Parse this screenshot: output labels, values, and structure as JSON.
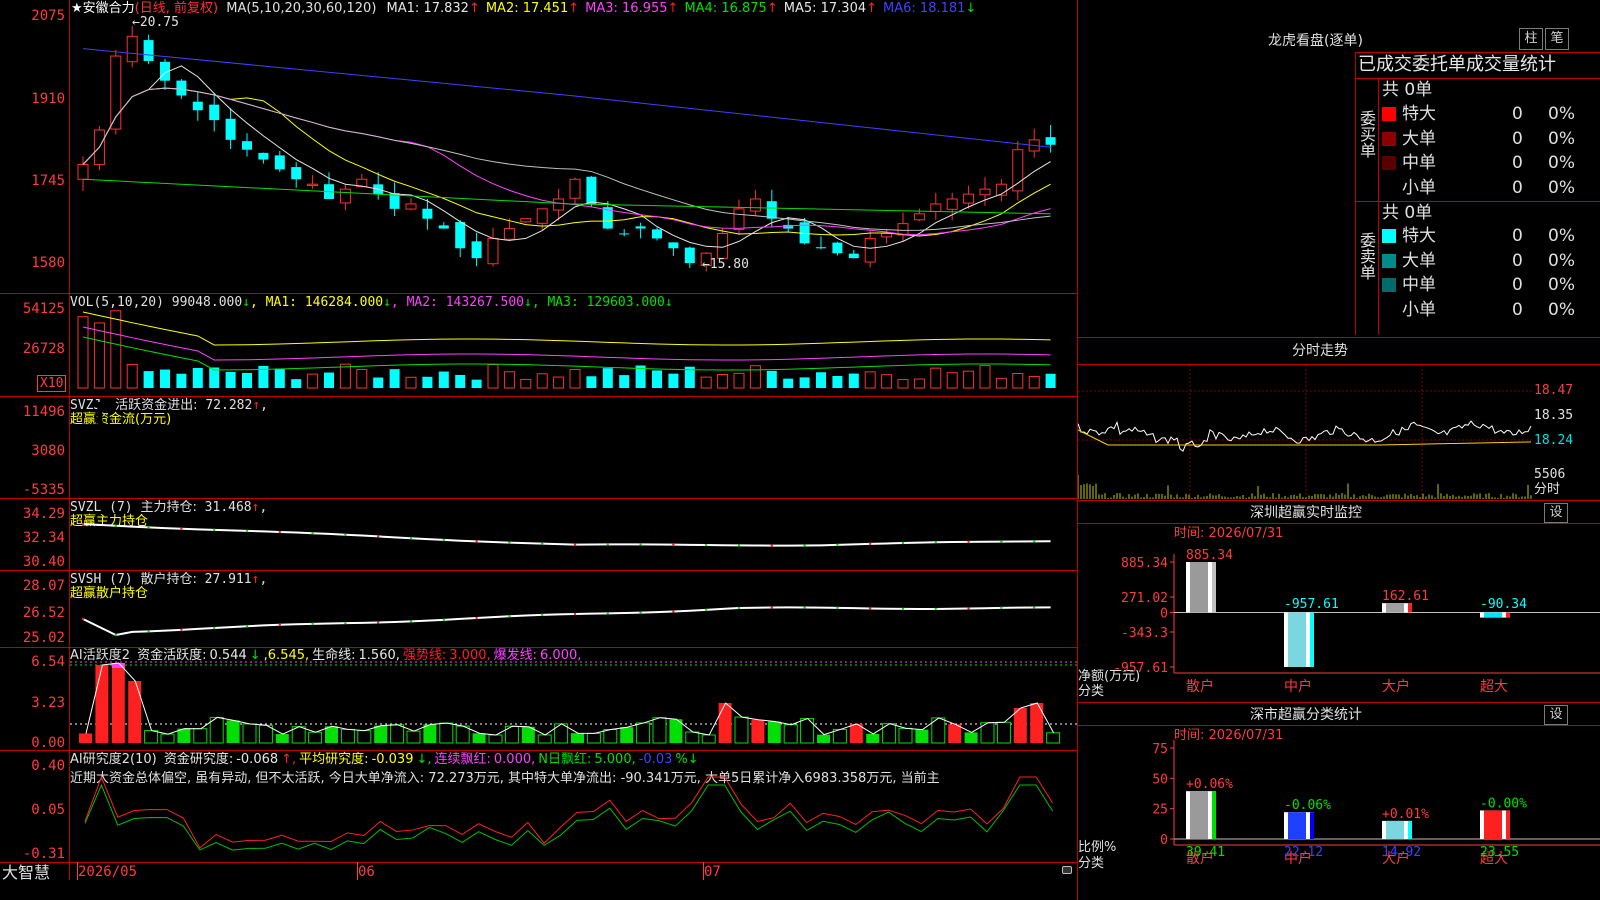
{
  "stock": {
    "star": "★",
    "name": "安徽合力",
    "period": "(日线, 前复权)",
    "ma_title": "MA(5,10,20,30,60,120)",
    "ma": [
      {
        "label": "MA1:",
        "value": "17.832",
        "arrow": "↑",
        "color": "#e6e6e6"
      },
      {
        "label": "MA2:",
        "value": "17.451",
        "arrow": "↑",
        "color": "#ffff00"
      },
      {
        "label": "MA3:",
        "value": "16.955",
        "arrow": "↑",
        "color": "#ff40ff"
      },
      {
        "label": "MA4:",
        "value": "16.875",
        "arrow": "↑",
        "color": "#00e000"
      },
      {
        "label": "MA5:",
        "value": "17.304",
        "arrow": "↑",
        "color": "#e6e6e6"
      },
      {
        "label": "MA6:",
        "value": "18.181",
        "arrow": "↓",
        "color": "#4040ff"
      }
    ],
    "high_label": "20.75",
    "low_label": "15.80",
    "y_labels": [
      "2075",
      "1910",
      "1745",
      "1580"
    ]
  },
  "vol": {
    "title": "VOL(5,10,20)",
    "value": "99048.000",
    "arrow": "↓",
    "ma": [
      {
        "label": "MA1:",
        "value": "146284.000",
        "arrow": "↓",
        "color": "#ffff00"
      },
      {
        "label": "MA2:",
        "value": "143267.500",
        "arrow": "↓",
        "color": "#ff40ff"
      },
      {
        "label": "MA3:",
        "value": "129603.000",
        "arrow": "↓",
        "color": "#00e000"
      }
    ],
    "y_labels": [
      "54125",
      "26728"
    ],
    "unit": "X10"
  },
  "svzj": {
    "title": "SVZJ",
    "label": "活跃资金进出:",
    "value": "72.282",
    "arrow": "↑",
    "subtitle": "超赢资金流(万元)",
    "y_labels": [
      "11496",
      "3080",
      "-5335"
    ]
  },
  "svzl": {
    "title": "SVZL (7)",
    "label": "主力持仓:",
    "value": "31.468",
    "arrow": "↑",
    "subtitle": "超赢主力持仓",
    "y_labels": [
      "34.29",
      "32.34",
      "30.40"
    ]
  },
  "svsh": {
    "title": "SVSH (7)",
    "label": "散户持仓:",
    "value": "27.911",
    "arrow": "↑",
    "subtitle": "超赢散户持仓",
    "y_labels": [
      "28.07",
      "26.52",
      "25.02"
    ]
  },
  "ai1": {
    "title": "AI活跃度2",
    "items": [
      {
        "text": "资金活跃度:",
        "color": "#e6e6e6"
      },
      {
        "text": "0.544",
        "color": "#e6e6e6"
      },
      {
        "text": "↓",
        "color": "#00e000"
      },
      {
        "text": ",6.545,",
        "color": "#ffff00"
      },
      {
        "text": "生命线:",
        "color": "#e6e6e6"
      },
      {
        "text": "1.560,",
        "color": "#e6e6e6"
      },
      {
        "text": "强势线:",
        "color": "#ff2020"
      },
      {
        "text": "3.000,",
        "color": "#ff2020"
      },
      {
        "text": "爆发线:",
        "color": "#ff40ff"
      },
      {
        "text": "6.000,",
        "color": "#ff40ff"
      }
    ],
    "y_labels": [
      "6.54",
      "3.23",
      "0.00"
    ]
  },
  "ai2": {
    "title": "AI研究度2(10)",
    "items": [
      {
        "text": "资金研究度:",
        "color": "#e6e6e6"
      },
      {
        "text": "-0.068",
        "color": "#e6e6e6"
      },
      {
        "text": "↑,",
        "color": "#ff2020"
      },
      {
        "text": "平均研究度:",
        "color": "#ffff00"
      },
      {
        "text": "-0.039",
        "color": "#ffff00"
      },
      {
        "text": "↓,",
        "color": "#00e000"
      },
      {
        "text": "连续飘红:",
        "color": "#ff40ff"
      },
      {
        "text": "0.000,",
        "color": "#ff40ff"
      },
      {
        "text": "N日飘红:",
        "color": "#00e000"
      },
      {
        "text": "5.000,",
        "color": "#00e000"
      },
      {
        "text": "-0.03",
        "color": "#4040ff"
      },
      {
        "text": "%↓",
        "color": "#00e000"
      }
    ],
    "comment": "近期大资金总体偏空, 虽有异动, 但不太活跃, 今日大单净流入: 72.273万元, 其中特大单净流出: -90.341万元, 大单5日累计净入6983.358万元, 当前主",
    "y_labels": [
      "0.40",
      "0.05",
      "-0.31"
    ]
  },
  "footer": {
    "brand": "大智慧",
    "dates": [
      "2026/05",
      "06",
      "07"
    ]
  },
  "lhb": {
    "title": "龙虎看盘(逐单)",
    "btn_bar": "柱",
    "btn_pen": "笔",
    "header": "已成交委托单成交量统计",
    "buy_label": "委买单",
    "sell_label": "委卖单",
    "buy_total": "共 0单",
    "sell_total": "共 0单",
    "buy_rows": [
      {
        "name": "特大",
        "count": "0",
        "pct": "0%",
        "color": "#ff0000"
      },
      {
        "name": "大单",
        "count": "0",
        "pct": "0%",
        "color": "#8b0000"
      },
      {
        "name": "中单",
        "count": "0",
        "pct": "0%",
        "color": "#5a0000"
      },
      {
        "name": "小单",
        "count": "0",
        "pct": "0%",
        "color": "#000000"
      }
    ],
    "sell_rows": [
      {
        "name": "特大",
        "count": "0",
        "pct": "0%",
        "color": "#00ffff"
      },
      {
        "name": "大单",
        "count": "0",
        "pct": "0%",
        "color": "#008b8b"
      },
      {
        "name": "中单",
        "count": "0",
        "pct": "0%",
        "color": "#006b6b"
      },
      {
        "name": "小单",
        "count": "0",
        "pct": "0%",
        "color": "#000000"
      }
    ]
  },
  "intraday": {
    "title": "分时走势",
    "y_labels": [
      "18.47",
      "18.35",
      "18.24"
    ],
    "vol_label": "5506",
    "tag": "分时"
  },
  "monitor": {
    "title": "深圳超赢实时监控",
    "btn": "设",
    "time": "时间: 2026/07/31",
    "y_labels": [
      "885.34",
      "271.02",
      "0",
      "-343.3",
      "-957.61"
    ],
    "ylabel": "净额(万元)",
    "xlabel": "分类"
  },
  "classify": {
    "title": "深市超赢分类统计",
    "btn": "设",
    "time": "时间: 2026/07/31",
    "y_labels": [
      "75",
      "50",
      "25",
      "0"
    ],
    "ylabel": "比例%",
    "xlabel": "分类"
  },
  "chart_data": [
    {
      "type": "bar",
      "title": "深圳超赢实时监控",
      "categories": [
        "散户",
        "中户",
        "大户",
        "超大"
      ],
      "values": [
        885.34,
        -957.61,
        162.61,
        -90.34
      ],
      "ylabel": "净额(万元)",
      "xlabel": "分类",
      "ylim": [
        -957.61,
        885.34
      ]
    },
    {
      "type": "bar",
      "title": "深市超赢分类统计",
      "categories": [
        "散户",
        "中户",
        "大户",
        "超大"
      ],
      "values": [
        39.41,
        22.12,
        14.92,
        23.55
      ],
      "changes": [
        "+0.06%",
        "-0.06%",
        "+0.01%",
        "-0.00%"
      ],
      "ylabel": "比例%",
      "xlabel": "分类",
      "ylim": [
        0,
        75
      ]
    },
    {
      "type": "line",
      "title": "安徽合力 (日线, 前复权)",
      "series": [
        {
          "name": "MA1",
          "values": [
            17.832
          ]
        },
        {
          "name": "MA2",
          "values": [
            17.451
          ]
        },
        {
          "name": "MA3",
          "values": [
            16.955
          ]
        },
        {
          "name": "MA4",
          "values": [
            16.875
          ]
        },
        {
          "name": "MA5",
          "values": [
            17.304
          ]
        },
        {
          "name": "MA6",
          "values": [
            18.181
          ]
        }
      ],
      "ylim": [
        15.8,
        20.75
      ]
    }
  ]
}
